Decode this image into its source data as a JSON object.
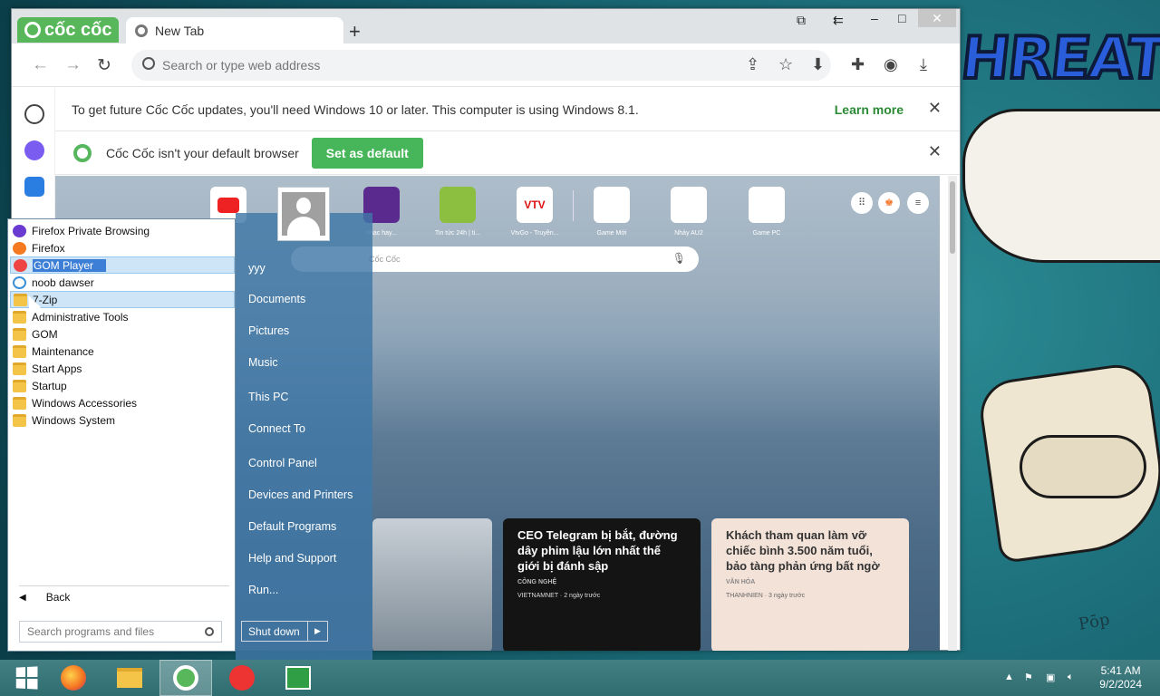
{
  "browser": {
    "brand": "cốc cốc",
    "tab_title": "New Tab",
    "omnibox_placeholder": "Search or type web address",
    "update_bar": {
      "message": "To get future Cốc Cốc updates, you'll need Windows 10 or later. This computer is using Windows 8.1.",
      "link": "Learn more"
    },
    "default_bar": {
      "message": "Cốc Cốc isn't your default browser",
      "button": "Set as default"
    },
    "speed_dials": [
      {
        "label": "",
        "color": "#ffffff"
      },
      {
        "label": "",
        "color": "#8a2b3f"
      },
      {
        "label": "nhạc hay...",
        "color": "#5b2a8e"
      },
      {
        "label": "Tin tức 24h | ti...",
        "color": "#8cbf3f"
      },
      {
        "label": "VtvGo - Truyền...",
        "color": "#ffffff"
      },
      {
        "label": "Game Mới",
        "color": "#ffffff"
      },
      {
        "label": "Nhảy AU2",
        "color": "#ffffff"
      },
      {
        "label": "Game PC",
        "color": "#ffffff"
      }
    ],
    "ntp_search_placeholder": "Cốc Cốc",
    "news": [
      {
        "title": "CEO Telegram bị bắt, đường dây phim lậu lớn nhất thế giới bị đánh sập",
        "category": "CÔNG NGHỆ",
        "source": "VIETNAMNET · 2 ngày trước"
      },
      {
        "title": "Khách tham quan làm vỡ chiếc bình 3.500 năm tuổi, bảo tàng phản ứng bất ngờ",
        "category": "VĂN HÓA",
        "source": "THANHNIEN · 3 ngày trước"
      }
    ]
  },
  "start_menu": {
    "programs": [
      {
        "label": "Firefox Private Browsing",
        "icon": "firefox-private-icon",
        "type": "app"
      },
      {
        "label": "Firefox",
        "icon": "firefox-icon",
        "type": "app"
      },
      {
        "label": "GOM Player",
        "icon": "gom-player-icon",
        "type": "app"
      },
      {
        "label": "noob dawser",
        "icon": "ie-icon",
        "type": "app"
      },
      {
        "label": "7-Zip",
        "icon": "folder-icon",
        "type": "folder"
      },
      {
        "label": "Administrative Tools",
        "icon": "folder-icon",
        "type": "folder"
      },
      {
        "label": "GOM",
        "icon": "folder-icon",
        "type": "folder"
      },
      {
        "label": "Maintenance",
        "icon": "folder-icon",
        "type": "folder"
      },
      {
        "label": "Start Apps",
        "icon": "folder-icon",
        "type": "folder"
      },
      {
        "label": "Startup",
        "icon": "folder-icon",
        "type": "folder"
      },
      {
        "label": "Windows Accessories",
        "icon": "folder-icon",
        "type": "folder"
      },
      {
        "label": "Windows System",
        "icon": "folder-icon",
        "type": "folder"
      }
    ],
    "back_label": "Back",
    "search_placeholder": "Search programs and files",
    "right_items": [
      "yyy",
      "Documents",
      "Pictures",
      "Music",
      "This PC",
      "Connect To",
      "Control Panel",
      "Devices and Printers",
      "Default Programs",
      "Help and Support",
      "Run..."
    ],
    "shutdown_label": "Shut down"
  },
  "taskbar": {
    "apps": [
      "start-button",
      "firefox",
      "file-explorer",
      "coc-coc",
      "gom-player",
      "store"
    ],
    "time": "5:41 AM",
    "date": "9/2/2024"
  },
  "desktop": {
    "art_text": "HREAT",
    "signature": "Pōp"
  }
}
